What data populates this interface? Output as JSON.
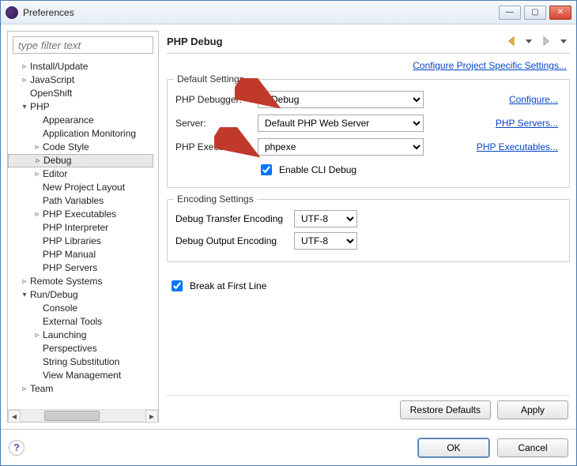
{
  "window": {
    "title": "Preferences"
  },
  "filter": {
    "placeholder": "type filter text"
  },
  "tree": {
    "items": [
      {
        "label": "Install/Update",
        "depth": 1,
        "twisty": "▹"
      },
      {
        "label": "JavaScript",
        "depth": 1,
        "twisty": "▹"
      },
      {
        "label": "OpenShift",
        "depth": 1,
        "twisty": ""
      },
      {
        "label": "PHP",
        "depth": 1,
        "twisty": "▾"
      },
      {
        "label": "Appearance",
        "depth": 2,
        "twisty": ""
      },
      {
        "label": "Application Monitoring",
        "depth": 2,
        "twisty": ""
      },
      {
        "label": "Code Style",
        "depth": 2,
        "twisty": "▹"
      },
      {
        "label": "Debug",
        "depth": 2,
        "twisty": "▹",
        "selected": true
      },
      {
        "label": "Editor",
        "depth": 2,
        "twisty": "▹"
      },
      {
        "label": "New Project Layout",
        "depth": 2,
        "twisty": ""
      },
      {
        "label": "Path Variables",
        "depth": 2,
        "twisty": ""
      },
      {
        "label": "PHP Executables",
        "depth": 2,
        "twisty": "▹"
      },
      {
        "label": "PHP Interpreter",
        "depth": 2,
        "twisty": ""
      },
      {
        "label": "PHP Libraries",
        "depth": 2,
        "twisty": ""
      },
      {
        "label": "PHP Manual",
        "depth": 2,
        "twisty": ""
      },
      {
        "label": "PHP Servers",
        "depth": 2,
        "twisty": ""
      },
      {
        "label": "Remote Systems",
        "depth": 1,
        "twisty": "▹"
      },
      {
        "label": "Run/Debug",
        "depth": 1,
        "twisty": "▾"
      },
      {
        "label": "Console",
        "depth": 2,
        "twisty": ""
      },
      {
        "label": "External Tools",
        "depth": 2,
        "twisty": ""
      },
      {
        "label": "Launching",
        "depth": 2,
        "twisty": "▹"
      },
      {
        "label": "Perspectives",
        "depth": 2,
        "twisty": ""
      },
      {
        "label": "String Substitution",
        "depth": 2,
        "twisty": ""
      },
      {
        "label": "View Management",
        "depth": 2,
        "twisty": ""
      },
      {
        "label": "Team",
        "depth": 1,
        "twisty": "▹"
      }
    ]
  },
  "page": {
    "title": "PHP Debug",
    "project_link": "Configure Project Specific Settings...",
    "default_group": "Default Settings",
    "debugger_label": "PHP Debugger:",
    "debugger_value": "XDebug",
    "server_label": "Server:",
    "server_value": "Default PHP Web Server",
    "exe_label": "PHP Executable:",
    "exe_value": "phpexe",
    "enable_cli_label": "Enable CLI Debug",
    "link_configure": "Configure...",
    "link_servers": "PHP Servers...",
    "link_executables": "PHP Executables...",
    "encoding_group": "Encoding Settings",
    "transfer_label": "Debug Transfer Encoding",
    "transfer_value": "UTF-8",
    "output_label": "Debug Output Encoding",
    "output_value": "UTF-8",
    "break_label": "Break at First Line"
  },
  "buttons": {
    "restore": "Restore Defaults",
    "apply": "Apply",
    "ok": "OK",
    "cancel": "Cancel"
  },
  "state": {
    "enable_cli_checked": true,
    "break_first_line_checked": true
  }
}
